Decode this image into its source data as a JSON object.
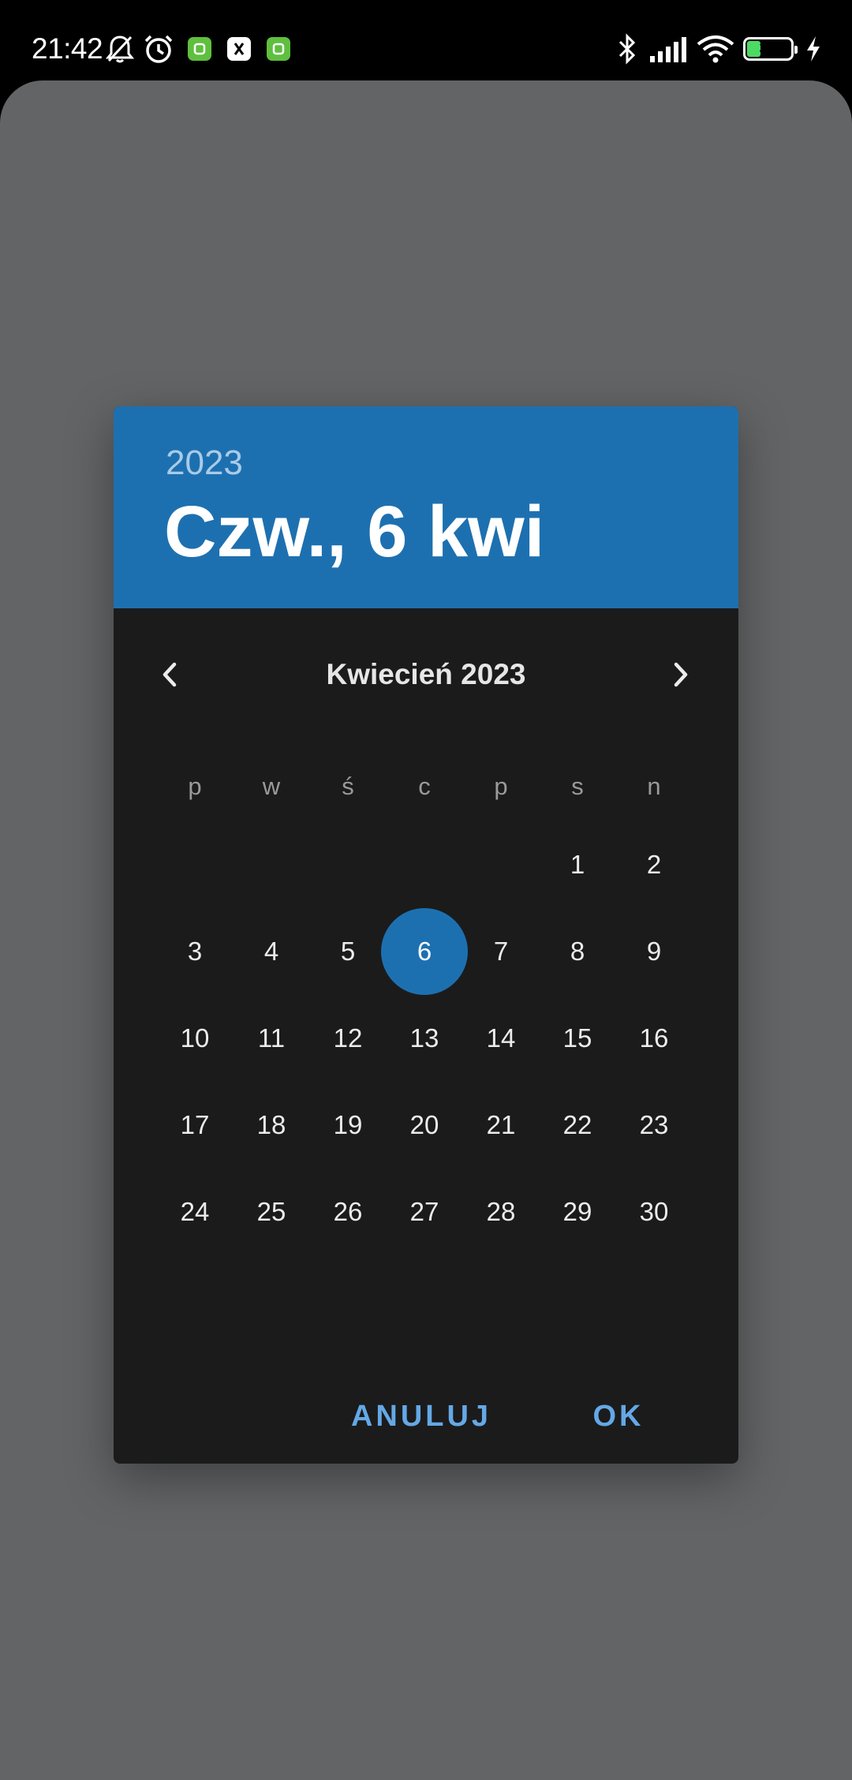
{
  "status_bar": {
    "time": "21:42",
    "battery_level": "31",
    "icons": [
      "bell-off-icon",
      "alarm-icon",
      "app-badge-icon",
      "app-badge-icon",
      "app-badge-icon",
      "bluetooth-icon",
      "signal-icon",
      "wifi-icon",
      "battery-icon",
      "charging-icon"
    ]
  },
  "dialog": {
    "header": {
      "year": "2023",
      "selected_date": "Czw., 6 kwi"
    },
    "month_label": "Kwiecień 2023",
    "weekdays": [
      "p",
      "w",
      "ś",
      "c",
      "p",
      "s",
      "n"
    ],
    "weeks": [
      [
        "",
        "",
        "",
        "",
        "",
        "1",
        "2"
      ],
      [
        "3",
        "4",
        "5",
        "6",
        "7",
        "8",
        "9"
      ],
      [
        "10",
        "11",
        "12",
        "13",
        "14",
        "15",
        "16"
      ],
      [
        "17",
        "18",
        "19",
        "20",
        "21",
        "22",
        "23"
      ],
      [
        "24",
        "25",
        "26",
        "27",
        "28",
        "29",
        "30"
      ]
    ],
    "selected_day": "6",
    "actions": {
      "cancel": "ANULUJ",
      "ok": "OK"
    }
  },
  "colors": {
    "accent": "#1d70b0",
    "dialog_bg": "#1b1b1b",
    "scrim": "#636466",
    "button_text": "#64a8e6"
  }
}
